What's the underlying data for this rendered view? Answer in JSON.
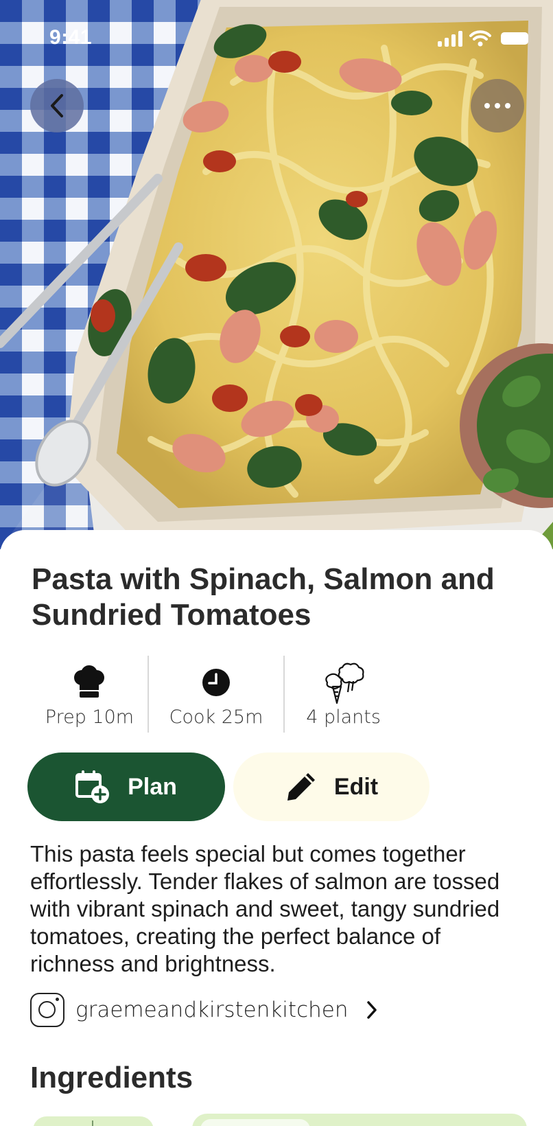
{
  "status_bar": {
    "time": "9:41"
  },
  "recipe": {
    "title": "Pasta with Spinach, Salmon and Sundried Tomatoes",
    "stats": [
      {
        "icon": "chef-hat-icon",
        "label": "Prep 10m"
      },
      {
        "icon": "clock-icon",
        "label": "Cook 25m"
      },
      {
        "icon": "vegetables-icon",
        "label": "4 plants"
      }
    ],
    "description": "This pasta feels special but comes together effortlessly. Tender flakes of salmon are tossed with vibrant spinach and sweet, tangy sundried tomatoes, creating the perfect balance of richness and brightness.",
    "source": {
      "icon": "instagram-icon",
      "handle": "graemeandkirstenkitchen"
    }
  },
  "actions": {
    "plan_label": "Plan",
    "edit_label": "Edit"
  },
  "sections": {
    "ingredients_heading": "Ingredients"
  },
  "colors": {
    "primary_green": "#1b5532",
    "edit_bg": "#fefbe9",
    "chip_green": "#dff1c8"
  }
}
